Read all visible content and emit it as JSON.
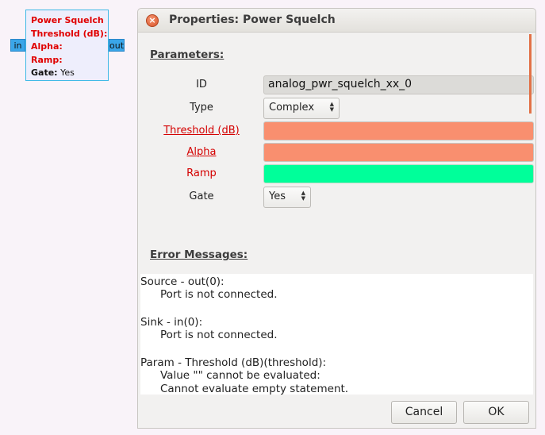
{
  "block": {
    "title": "Power Squelch",
    "params": [
      "Threshold (dB):",
      "Alpha:",
      "Ramp:"
    ],
    "gate_label": "Gate:",
    "gate_value": "Yes",
    "in_port": "in",
    "out_port": "out"
  },
  "dialog": {
    "title": "Properties: Power Squelch",
    "close_glyph": "×",
    "parameters_heading": "Parameters:",
    "fields": {
      "id_label": "ID",
      "id_value": "analog_pwr_squelch_xx_0",
      "type_label": "Type",
      "type_value": "Complex",
      "threshold_label": "Threshold (dB)",
      "alpha_label": "Alpha",
      "ramp_label": "Ramp",
      "gate_label": "Gate",
      "gate_value": "Yes"
    },
    "errors_heading": "Error Messages:",
    "errors": [
      "Source - out(0):",
      "Port is not connected.",
      "Sink - in(0):",
      "Port is not connected.",
      "Param - Threshold (dB)(threshold):",
      "Value \"\" cannot be evaluated:",
      "Cannot evaluate empty statement."
    ],
    "cancel_label": "Cancel",
    "ok_label": "OK"
  },
  "colors": {
    "invalid_field": "#f98f6f",
    "valid_field": "#00ff9a",
    "required_label": "#d40000",
    "port": "#3aa6e9"
  },
  "icons": {
    "close": "close-icon",
    "spinner": "up-down-arrows-icon"
  }
}
